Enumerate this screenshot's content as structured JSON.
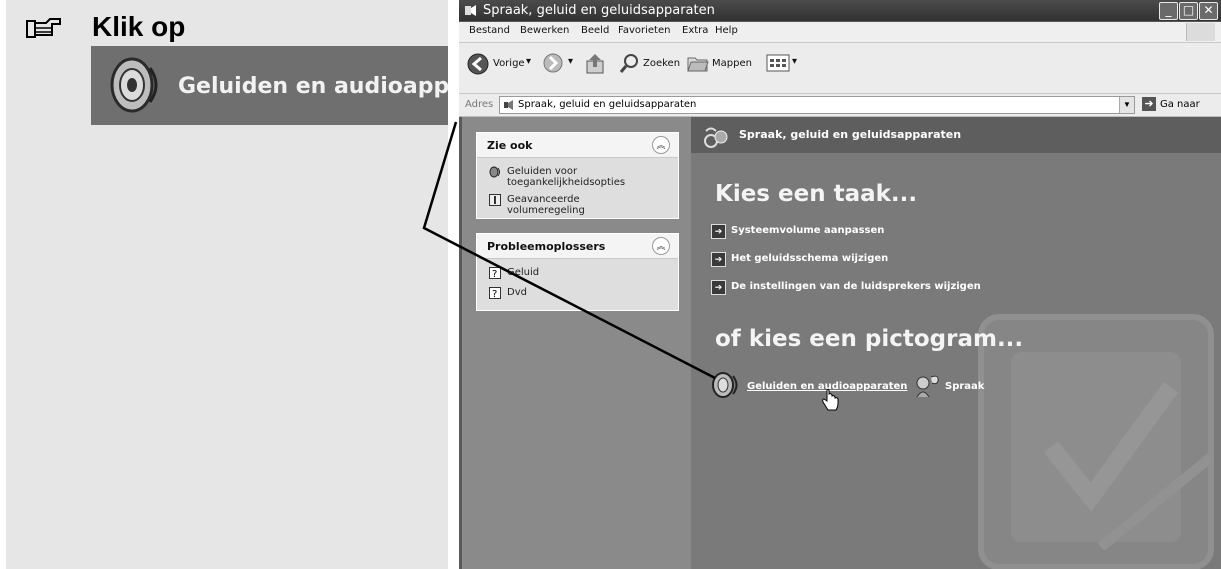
{
  "instruction": {
    "title": "Klik op",
    "zoom_label": "Geluiden en audioapparaten"
  },
  "window": {
    "title": "Spraak, geluid en geluidsapparaten",
    "menu": [
      "Bestand",
      "Bewerken",
      "Beeld",
      "Favorieten",
      "Extra",
      "Help"
    ],
    "toolbar": {
      "back_label": "Vorige",
      "search_label": "Zoeken",
      "folders_label": "Mappen"
    },
    "address": {
      "label": "Adres",
      "value": "Spraak, geluid en geluidsapparaten",
      "go_label": "Ga naar"
    }
  },
  "sidebar": {
    "see_also": {
      "title": "Zie ook",
      "items": [
        "Geluiden voor toegankelijkheidsopties",
        "Geavanceerde volumeregeling"
      ]
    },
    "troubleshooters": {
      "title": "Probleemoplossers",
      "items": [
        "Geluid",
        "Dvd"
      ]
    }
  },
  "content": {
    "header_title": "Spraak, geluid en geluidsapparaten",
    "task_heading": "Kies een taak...",
    "tasks": [
      "Systeemvolume aanpassen",
      "Het geluidsschema wijzigen",
      "De instellingen van de luidsprekers wijzigen"
    ],
    "icon_heading": "of kies een pictogram...",
    "icons": [
      {
        "label": "Geluiden en audioapparaten",
        "icon": "speaker-icon"
      },
      {
        "label": "Spraak",
        "icon": "speech-icon"
      }
    ]
  },
  "colors": {
    "titlebar": "#3d3d3d",
    "content_bg": "#7a7a7a",
    "sidebar_bg": "#8a8a8a",
    "zoom_bg": "#6f6f6f"
  }
}
